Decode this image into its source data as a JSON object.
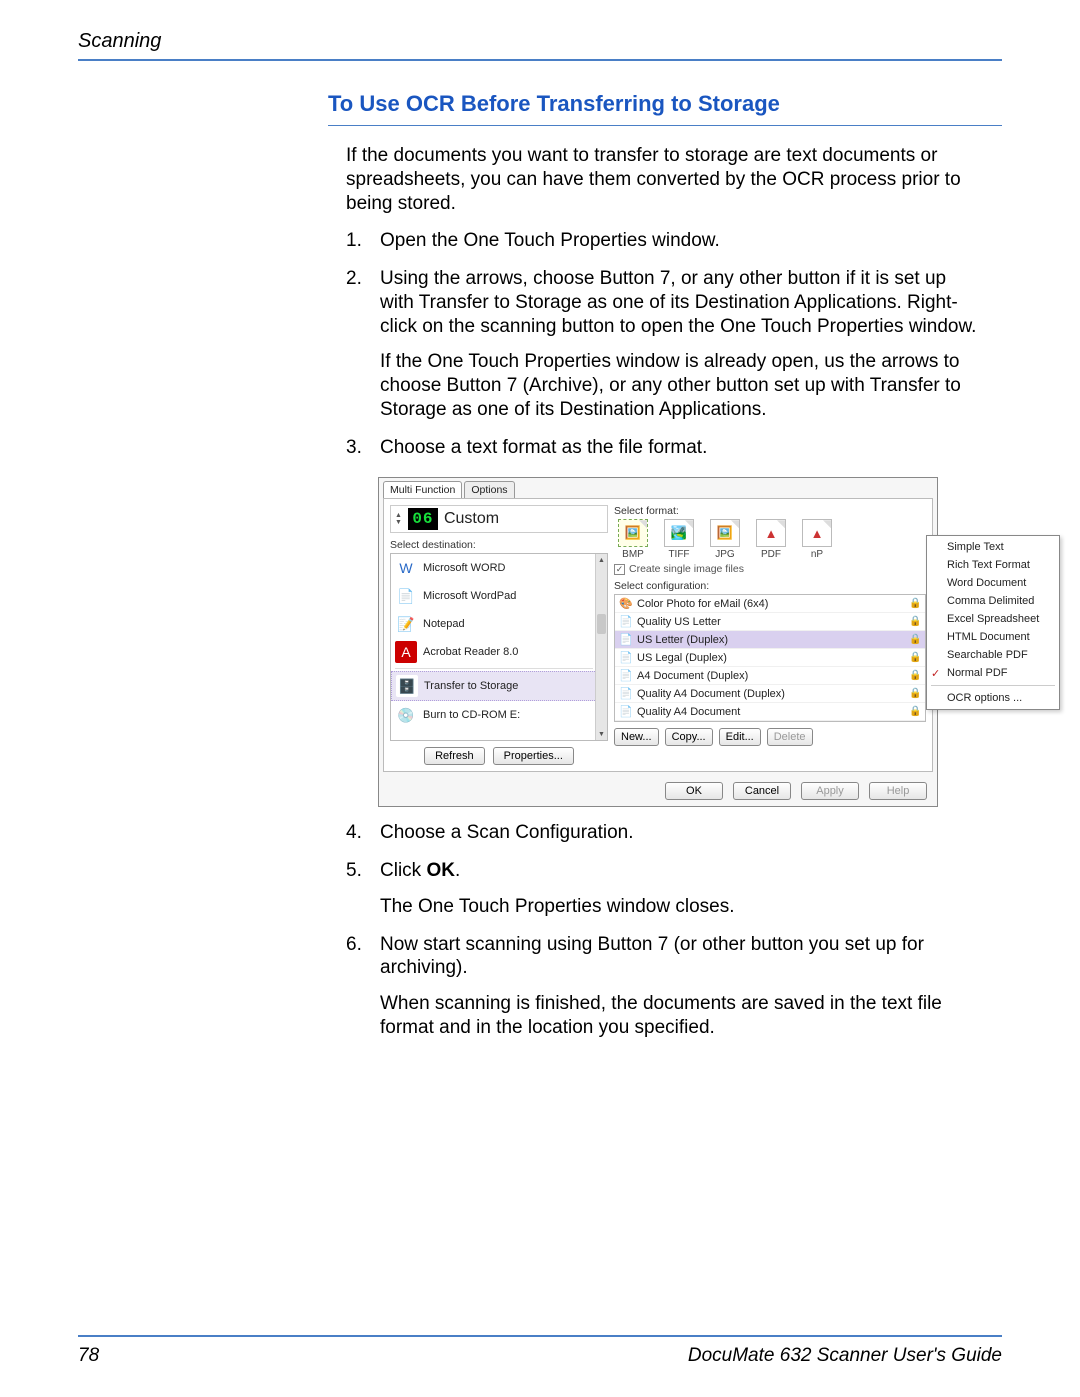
{
  "header": {
    "section": "Scanning"
  },
  "title": "To Use OCR Before Transferring to Storage",
  "intro": "If the documents you want to transfer to storage are text documents or spreadsheets, you can have them converted by the OCR process prior to being stored.",
  "steps": {
    "s1": "Open the One Touch Properties window.",
    "s2": "Using the arrows, choose Button 7, or any other button if it is set up with Transfer to Storage as one of its Destination Applications. Right-click on the scanning button to open the One Touch Properties window.",
    "s2b": "If the One Touch Properties window is already open, us the arrows to choose Button 7 (Archive), or any other button set up with Transfer to Storage as one of its Destination Applications.",
    "s3": "Choose a text format as the file format.",
    "s4": "Choose a Scan Configuration.",
    "s5_pre": "Click ",
    "s5_bold": "OK",
    "s5_post": ".",
    "s5b": "The One Touch Properties window closes.",
    "s6": "Now start scanning using Button 7 (or other button you set up for archiving).",
    "s6b": "When scanning is finished, the documents are saved in the text file format and in the location you specified."
  },
  "panel": {
    "tabs": {
      "active": "Multi Function",
      "inactive": "Options"
    },
    "button_number": "06",
    "button_name": "Custom",
    "select_dest_label": "Select destination:",
    "destinations": [
      "Microsoft WORD",
      "Microsoft WordPad",
      "Notepad",
      "Acrobat Reader 8.0",
      "Transfer to Storage",
      "Burn to CD-ROM  E:"
    ],
    "selected_dest_index": 4,
    "left_buttons": {
      "refresh": "Refresh",
      "properties": "Properties..."
    },
    "select_format_label": "Select format:",
    "formats": [
      "BMP",
      "TIFF",
      "JPG",
      "PDF",
      "nP"
    ],
    "selected_format_index": 0,
    "create_single": "Create single image files",
    "select_config_label": "Select configuration:",
    "configs": [
      "Color Photo for eMail (6x4)",
      "Quality US Letter",
      "US Letter (Duplex)",
      "US Legal (Duplex)",
      "A4 Document (Duplex)",
      "Quality A4 Document (Duplex)",
      "Quality A4 Document"
    ],
    "selected_config_index": 2,
    "right_buttons": {
      "new": "New...",
      "copy": "Copy...",
      "edit": "Edit...",
      "delete": "Delete"
    },
    "bottom_buttons": {
      "ok": "OK",
      "cancel": "Cancel",
      "apply": "Apply",
      "help": "Help"
    },
    "context_menu": [
      "Simple Text",
      "Rich Text Format",
      "Word Document",
      "Comma Delimited",
      "Excel Spreadsheet",
      "HTML Document",
      "Searchable PDF",
      "Normal PDF"
    ],
    "context_checked_index": 7,
    "context_footer": "OCR options ..."
  },
  "footer": {
    "page": "78",
    "guide": "DocuMate 632 Scanner User's Guide"
  }
}
